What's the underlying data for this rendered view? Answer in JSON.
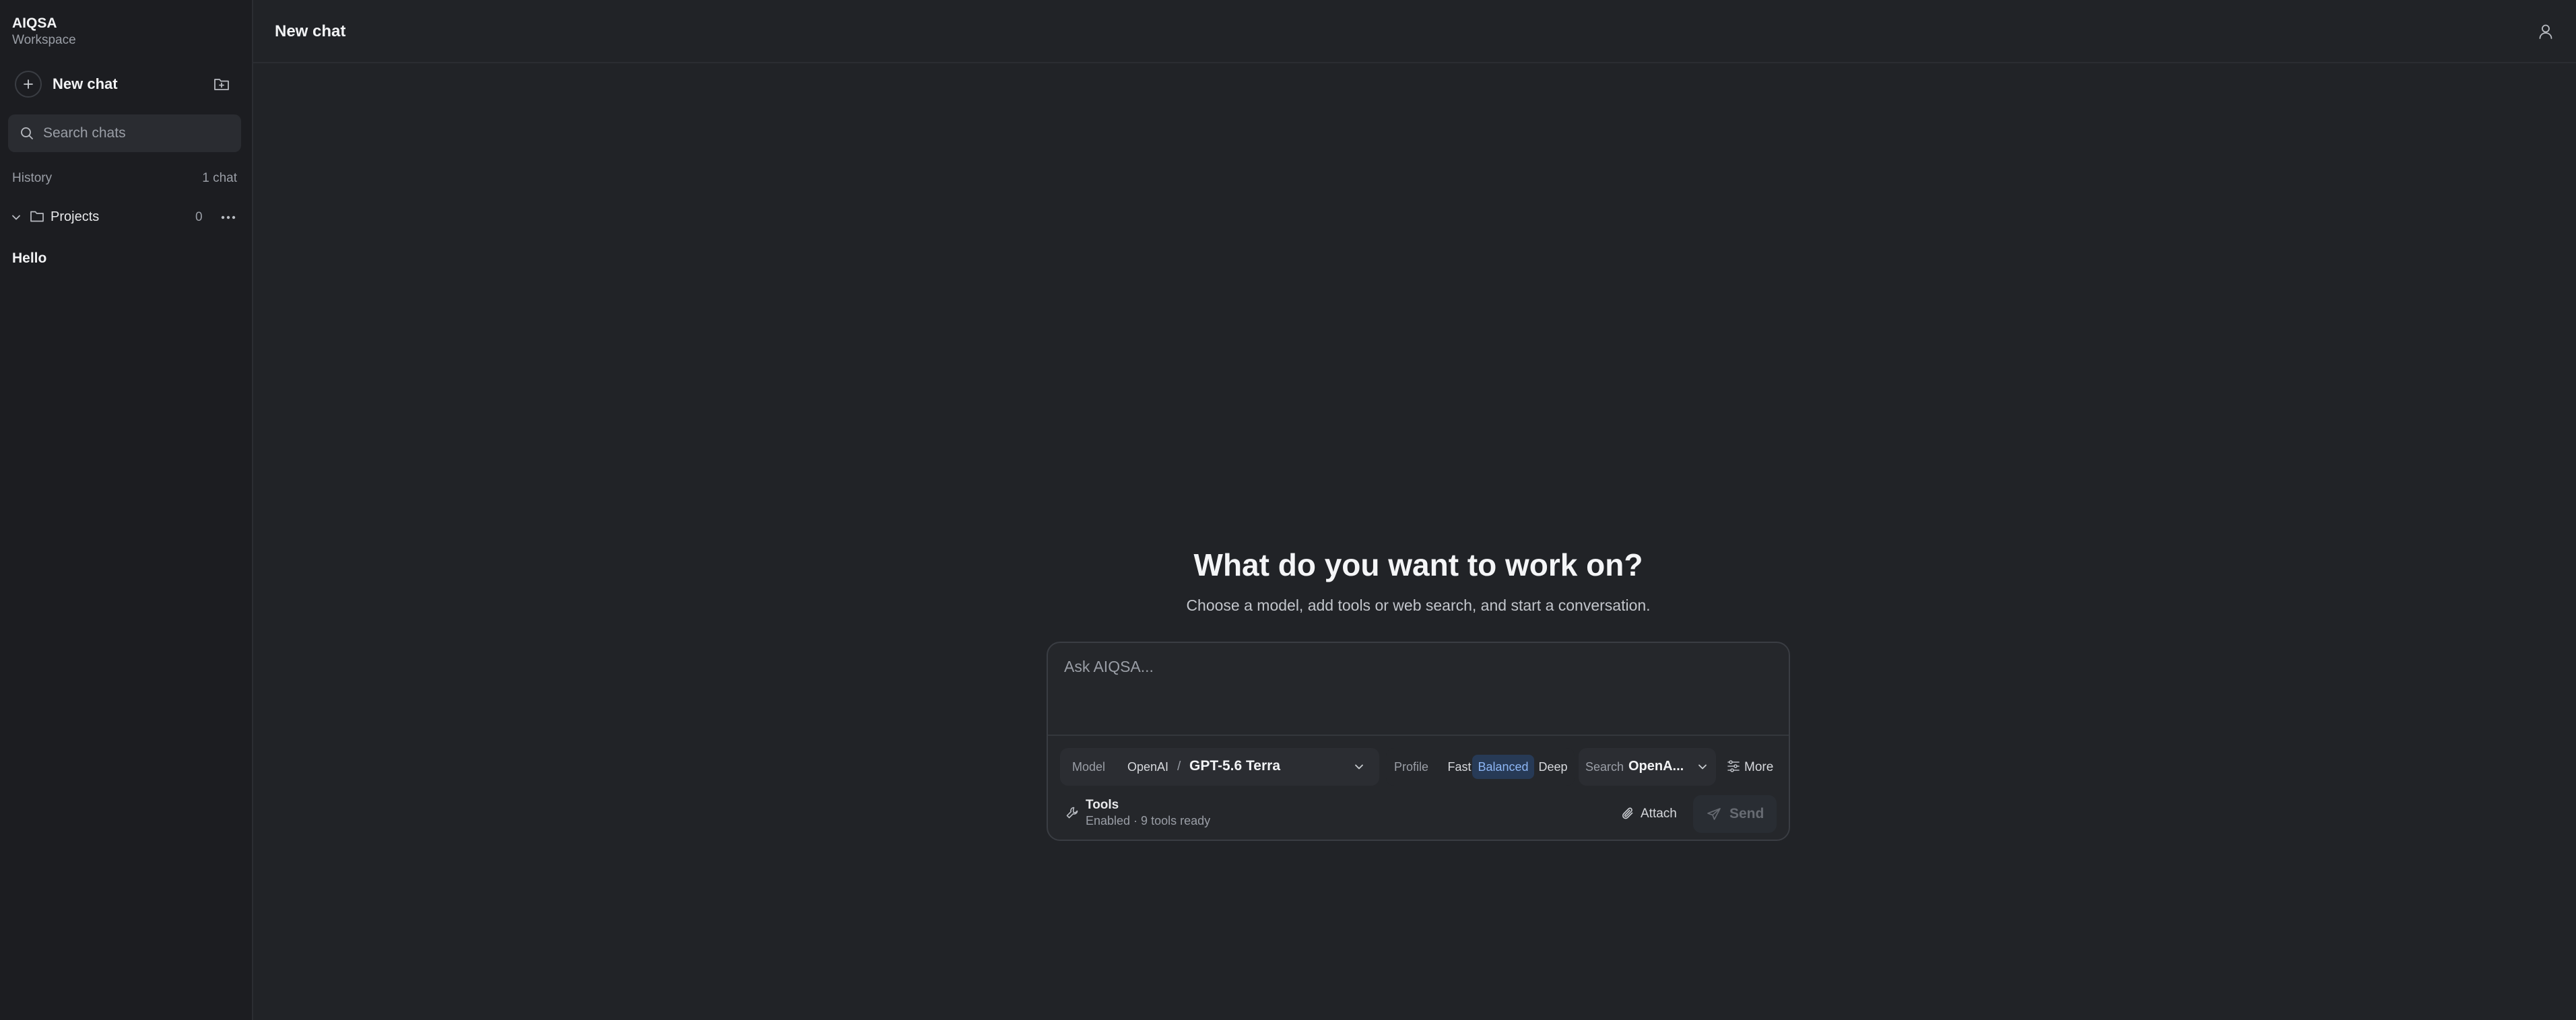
{
  "sidebar": {
    "brand_name": "AIQSA",
    "brand_sub": "Workspace",
    "new_chat_label": "New chat",
    "search_placeholder": "Search chats",
    "history_label": "History",
    "history_count": "1 chat",
    "projects_label": "Projects",
    "projects_count": "0",
    "chats": [
      {
        "title": "Hello"
      }
    ]
  },
  "header": {
    "title": "New chat"
  },
  "main": {
    "hero_title": "What do you want to work on?",
    "hero_subtitle": "Choose a model, add tools or web search, and start a conversation.",
    "composer": {
      "placeholder": "Ask AIQSA...",
      "model_label": "Model",
      "model_provider": "OpenAI",
      "model_separator": "/",
      "model_name": "GPT-5.6 Terra",
      "profile_label": "Profile",
      "profile_options": [
        "Fast",
        "Balanced",
        "Deep"
      ],
      "profile_selected": "Balanced",
      "search_label": "Search",
      "search_value": "OpenA...",
      "more_label": "More",
      "tools_title": "Tools",
      "tools_status": "Enabled · 9 tools ready",
      "attach_label": "Attach",
      "send_label": "Send"
    }
  },
  "colors": {
    "background": "#212327",
    "sidebar": "#1c1d21",
    "accent_selected_bg": "#273a56",
    "accent_selected_text": "#8db6f5"
  },
  "icons": {
    "new_chat": "plus-icon",
    "new_folder": "folder-plus-icon",
    "search": "search-icon",
    "projects_toggle": "chevron-down-icon",
    "projects_folder": "folder-icon",
    "projects_menu": "more-horizontal-icon",
    "user": "user-icon",
    "model_dropdown": "chevron-down-icon",
    "more": "sliders-icon",
    "tools": "wrench-icon",
    "attach": "paperclip-icon",
    "send": "send-icon"
  }
}
